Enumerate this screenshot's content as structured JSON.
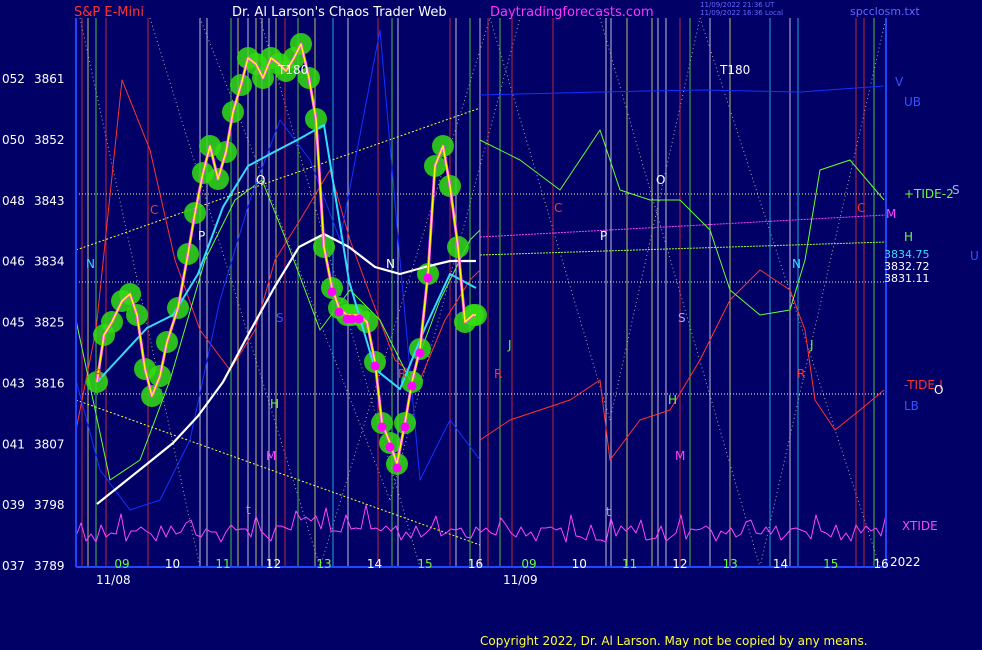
{
  "header": {
    "symbol": "S&P E-Mini",
    "site_title": "Dr. Al Larson's Chaos Trader Web",
    "site_url": "Daytradingforecasts.com",
    "timestamp_1": "11/09/2022 21:36 UT",
    "timestamp_2": "11/09/2022 16:36 Local",
    "file_name": "spcclosm.txt"
  },
  "copyright": "Copyright 2022, Dr. Al Larson. May not be copied by any means.",
  "colors": {
    "background": "#000066",
    "price_axis": "#ffffff",
    "price_line": "#ffff00",
    "glow": "#33dd11",
    "dots": "#ff00ff",
    "ma_fast": "#33ddff",
    "ma_slow": "#ffffff",
    "tide": "#66ff33",
    "xtide": "#ff44ff",
    "band": "#1133ff"
  },
  "chart_data": {
    "type": "line",
    "title": "S&P E-Mini",
    "y_axis": {
      "ticks": [
        {
          "short": "052",
          "price": 3861
        },
        {
          "short": "050",
          "price": 3852
        },
        {
          "short": "048",
          "price": 3843
        },
        {
          "short": "046",
          "price": 3834
        },
        {
          "short": "045",
          "price": 3825
        },
        {
          "short": "043",
          "price": 3816
        },
        {
          "short": "041",
          "price": 3807
        },
        {
          "short": "039",
          "price": 3798
        },
        {
          "short": "037",
          "price": 3789
        }
      ],
      "ylim": [
        3789,
        3861
      ]
    },
    "x_axis": {
      "hour_labels": [
        "09",
        "10",
        "11",
        "12",
        "13",
        "14",
        "15",
        "16",
        "09",
        "10",
        "11",
        "12",
        "13",
        "14",
        "15",
        "16"
      ],
      "date_labels": [
        "11/08",
        "11/09"
      ],
      "year_label": "2022"
    },
    "series": [
      {
        "name": "price",
        "x": [
          8.5,
          8.65,
          8.8,
          9.0,
          9.15,
          9.3,
          9.45,
          9.6,
          9.75,
          9.9,
          10.1,
          10.3,
          10.45,
          10.6,
          10.75,
          10.9,
          11.05,
          11.2,
          11.35,
          11.5,
          11.65,
          11.8,
          11.95,
          12.1,
          12.25,
          12.4,
          12.55,
          12.7,
          12.85,
          13.0,
          13.15,
          13.3,
          13.45,
          13.55,
          13.7,
          13.85,
          14.0,
          14.15,
          14.3,
          14.45,
          14.6,
          14.75,
          14.9,
          15.05,
          15.2,
          15.35,
          15.5,
          15.65,
          15.8,
          15.95,
          16.0
        ],
        "values": [
          3816,
          3823,
          3825,
          3828,
          3829,
          3826,
          3818,
          3814,
          3817,
          3822,
          3827,
          3835,
          3841,
          3847,
          3851,
          3846,
          3850,
          3856,
          3860,
          3864,
          3863,
          3861,
          3864,
          3863,
          3862,
          3864,
          3866,
          3861,
          3855,
          3836,
          3830,
          3827,
          3826,
          3826,
          3826,
          3825,
          3819,
          3810,
          3807,
          3804,
          3810,
          3816,
          3821,
          3832,
          3848,
          3851,
          3845,
          3836,
          3825,
          3826,
          3826
        ]
      },
      {
        "name": "moving average fast",
        "x": [
          8.5,
          9.0,
          9.5,
          10.0,
          10.5,
          11.0,
          11.5,
          12.0,
          12.5,
          13.0,
          13.5,
          14.0,
          14.5,
          15.0,
          15.5,
          16.0
        ],
        "values": [
          3816,
          3820,
          3824,
          3826,
          3832,
          3842,
          3848,
          3850,
          3852,
          3854,
          3831,
          3818,
          3815,
          3824,
          3832,
          3830
        ]
      },
      {
        "name": "moving average slow",
        "x": [
          8.5,
          9.0,
          9.5,
          10.0,
          10.5,
          11.0,
          11.5,
          12.0,
          12.5,
          13.0,
          13.5,
          14.0,
          14.5,
          15.0,
          15.5,
          16.0
        ],
        "values": [
          3798,
          3801,
          3804,
          3807,
          3811,
          3816,
          3823,
          3830,
          3836,
          3838,
          3836,
          3833,
          3832,
          3833,
          3834,
          3834
        ]
      }
    ],
    "price_annotations": [
      {
        "label": "3834.75",
        "price": 3834.75
      },
      {
        "label": "3832.72",
        "price": 3832.72
      },
      {
        "label": "3831.11",
        "price": 3831.11
      }
    ],
    "right_labels": [
      "V",
      "UB",
      "+TIDE-2",
      "S",
      "M",
      "H",
      "U",
      "-TIDE-I",
      "O",
      "LB",
      "XTIDE"
    ],
    "line_letters": [
      "N",
      "C",
      "P",
      "O",
      "S",
      "J",
      "R",
      "H",
      "M",
      "t",
      "T180"
    ]
  }
}
